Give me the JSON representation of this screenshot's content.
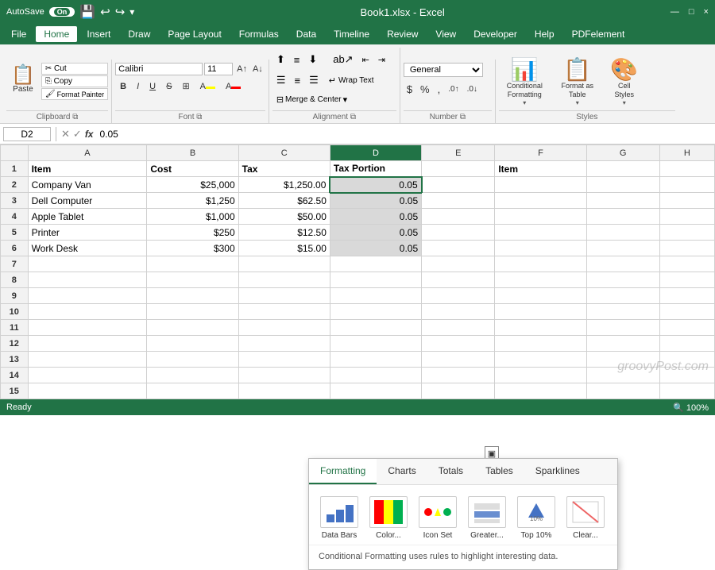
{
  "titleBar": {
    "autosave": "AutoSave",
    "toggleState": "On",
    "filename": "Book1.xlsx - Excel",
    "undoIcon": "↩",
    "redoIcon": "↪",
    "windowControls": [
      "—",
      "□",
      "×"
    ]
  },
  "menuBar": {
    "items": [
      "File",
      "Home",
      "Insert",
      "Draw",
      "Page Layout",
      "Formulas",
      "Data",
      "Timeline",
      "Review",
      "View",
      "Developer",
      "Help",
      "PDFelement"
    ],
    "active": "Home"
  },
  "ribbon": {
    "clipboard": {
      "label": "Clipboard",
      "paste": "Paste",
      "cut": "Cut",
      "copy": "Copy",
      "formatPainter": "Format Painter"
    },
    "font": {
      "label": "Font",
      "fontName": "Calibri",
      "fontSize": "11",
      "bold": "B",
      "italic": "I",
      "underline": "U",
      "strikethrough": "S",
      "borderBtn": "⊞",
      "fillColor": "A",
      "fontColor": "A"
    },
    "alignment": {
      "label": "Alignment",
      "wrapText": "Wrap Text",
      "mergeCenter": "Merge & Center"
    },
    "number": {
      "label": "Number",
      "format": "General",
      "currency": "$",
      "percent": "%",
      "comma": ","
    },
    "styles": {
      "label": "Styles",
      "conditional": "Conditional\nFormatting",
      "formatTable": "Format as\nTable",
      "cellStyles": "Cell\nStyles"
    }
  },
  "formulaBar": {
    "cellRef": "D2",
    "cancelIcon": "✕",
    "confirmIcon": "✓",
    "functionIcon": "fx",
    "value": "0.05"
  },
  "columnHeaders": [
    "",
    "A",
    "B",
    "C",
    "D",
    "E",
    "F",
    "G",
    "H"
  ],
  "rows": [
    {
      "num": "1",
      "cells": [
        {
          "v": "Item",
          "bold": true
        },
        {
          "v": "Cost",
          "bold": true
        },
        {
          "v": "Tax",
          "bold": true
        },
        {
          "v": "Tax Portion",
          "bold": true
        },
        {
          "v": ""
        },
        {
          "v": "Item",
          "bold": true
        },
        {
          "v": ""
        },
        {
          "v": ""
        }
      ]
    },
    {
      "num": "2",
      "cells": [
        {
          "v": "Company Van"
        },
        {
          "v": "$25,000",
          "right": true
        },
        {
          "v": "$1,250.00",
          "right": true
        },
        {
          "v": "0.05",
          "right": true,
          "sel": true
        },
        {
          "v": ""
        },
        {
          "v": ""
        },
        {
          "v": ""
        },
        {
          "v": ""
        }
      ]
    },
    {
      "num": "3",
      "cells": [
        {
          "v": "Dell Computer"
        },
        {
          "v": "$1,250",
          "right": true
        },
        {
          "v": "$62.50",
          "right": true
        },
        {
          "v": "0.05",
          "right": true,
          "sel": true
        },
        {
          "v": ""
        },
        {
          "v": ""
        },
        {
          "v": ""
        },
        {
          "v": ""
        }
      ]
    },
    {
      "num": "4",
      "cells": [
        {
          "v": "Apple Tablet"
        },
        {
          "v": "$1,000",
          "right": true
        },
        {
          "v": "$50.00",
          "right": true
        },
        {
          "v": "0.05",
          "right": true,
          "sel": true
        },
        {
          "v": ""
        },
        {
          "v": ""
        },
        {
          "v": ""
        },
        {
          "v": ""
        }
      ]
    },
    {
      "num": "5",
      "cells": [
        {
          "v": "Printer"
        },
        {
          "v": "$250",
          "right": true
        },
        {
          "v": "$12.50",
          "right": true
        },
        {
          "v": "0.05",
          "right": true,
          "sel": true
        },
        {
          "v": ""
        },
        {
          "v": ""
        },
        {
          "v": ""
        },
        {
          "v": ""
        }
      ]
    },
    {
      "num": "6",
      "cells": [
        {
          "v": "Work Desk"
        },
        {
          "v": "$300",
          "right": true
        },
        {
          "v": "$15.00",
          "right": true
        },
        {
          "v": "0.05",
          "right": true,
          "sel": true
        },
        {
          "v": ""
        },
        {
          "v": ""
        },
        {
          "v": ""
        },
        {
          "v": ""
        }
      ]
    },
    {
      "num": "7",
      "cells": [
        {
          "v": ""
        },
        {
          "v": ""
        },
        {
          "v": ""
        },
        {
          "v": ""
        },
        {
          "v": ""
        },
        {
          "v": ""
        },
        {
          "v": ""
        },
        {
          "v": ""
        }
      ]
    },
    {
      "num": "8",
      "cells": [
        {
          "v": ""
        },
        {
          "v": ""
        },
        {
          "v": ""
        },
        {
          "v": ""
        },
        {
          "v": ""
        },
        {
          "v": ""
        },
        {
          "v": ""
        },
        {
          "v": ""
        }
      ]
    },
    {
      "num": "9",
      "cells": [
        {
          "v": ""
        },
        {
          "v": ""
        },
        {
          "v": ""
        },
        {
          "v": ""
        },
        {
          "v": ""
        },
        {
          "v": ""
        },
        {
          "v": ""
        },
        {
          "v": ""
        }
      ]
    },
    {
      "num": "10",
      "cells": [
        {
          "v": ""
        },
        {
          "v": ""
        },
        {
          "v": ""
        },
        {
          "v": ""
        },
        {
          "v": ""
        },
        {
          "v": ""
        },
        {
          "v": ""
        },
        {
          "v": ""
        }
      ]
    },
    {
      "num": "11",
      "cells": [
        {
          "v": ""
        },
        {
          "v": ""
        },
        {
          "v": ""
        },
        {
          "v": ""
        },
        {
          "v": ""
        },
        {
          "v": ""
        },
        {
          "v": ""
        },
        {
          "v": ""
        }
      ]
    },
    {
      "num": "12",
      "cells": [
        {
          "v": ""
        },
        {
          "v": ""
        },
        {
          "v": ""
        },
        {
          "v": ""
        },
        {
          "v": ""
        },
        {
          "v": ""
        },
        {
          "v": ""
        },
        {
          "v": ""
        }
      ]
    },
    {
      "num": "13",
      "cells": [
        {
          "v": ""
        },
        {
          "v": ""
        },
        {
          "v": ""
        },
        {
          "v": ""
        },
        {
          "v": ""
        },
        {
          "v": ""
        },
        {
          "v": ""
        },
        {
          "v": ""
        }
      ]
    },
    {
      "num": "14",
      "cells": [
        {
          "v": ""
        },
        {
          "v": ""
        },
        {
          "v": ""
        },
        {
          "v": ""
        },
        {
          "v": ""
        },
        {
          "v": ""
        },
        {
          "v": ""
        },
        {
          "v": ""
        }
      ]
    },
    {
      "num": "15",
      "cells": [
        {
          "v": ""
        },
        {
          "v": ""
        },
        {
          "v": ""
        },
        {
          "v": ""
        },
        {
          "v": ""
        },
        {
          "v": ""
        },
        {
          "v": ""
        },
        {
          "v": ""
        }
      ]
    }
  ],
  "popup": {
    "tabs": [
      "Formatting",
      "Charts",
      "Totals",
      "Tables",
      "Sparklines"
    ],
    "activeTab": "Formatting",
    "icons": [
      {
        "label": "Data Bars",
        "icon": "▦"
      },
      {
        "label": "Color...",
        "icon": "🎨"
      },
      {
        "label": "Icon Set",
        "icon": "⚑"
      },
      {
        "label": "Greater...",
        "icon": "▶"
      },
      {
        "label": "Top 10%",
        "icon": "⬆"
      },
      {
        "label": "Clear...",
        "icon": "⬜"
      }
    ],
    "description": "Conditional Formatting uses rules to highlight interesting data."
  },
  "statusBar": {
    "mode": "Ready",
    "zoom": "100%"
  },
  "watermark": "groovyPost.com"
}
